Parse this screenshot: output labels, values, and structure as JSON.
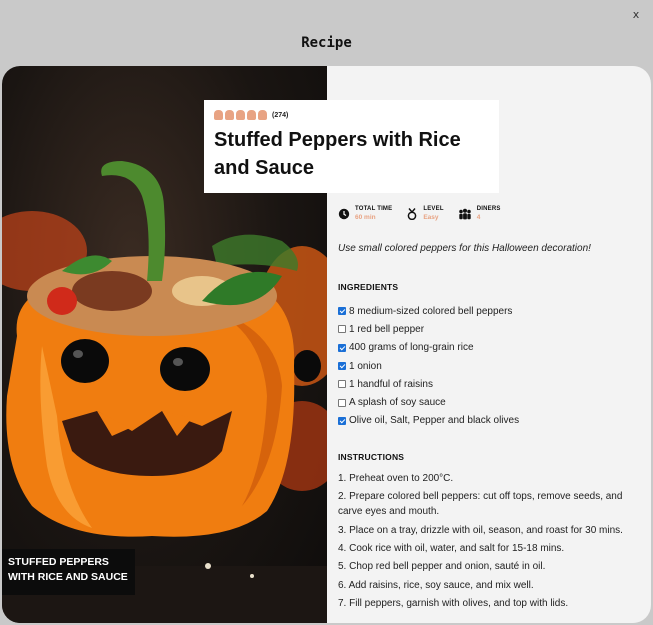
{
  "close_label": "x",
  "modal_title": "Recipe",
  "photo": {
    "caption": "STUFFED PEPPERS WITH RICE AND SAUCE"
  },
  "rating": {
    "count": "(274)",
    "star_color": "#e8a383"
  },
  "recipe": {
    "title": "Stuffed Peppers with Rice and Sauce",
    "tip": "Use small colored peppers for this Halloween decoration!"
  },
  "meta": [
    {
      "label": "TOTAL TIME",
      "value": "60 min",
      "icon": "clock-icon"
    },
    {
      "label": "LEVEL",
      "value": "Easy",
      "icon": "medal-icon"
    },
    {
      "label": "DINERS",
      "value": "4",
      "icon": "people-icon"
    }
  ],
  "ingredients_title": "INGREDIENTS",
  "ingredients": [
    {
      "text": "8 medium-sized colored bell peppers",
      "checked": true
    },
    {
      "text": "1 red bell pepper",
      "checked": false
    },
    {
      "text": "400 grams of long-grain rice",
      "checked": true
    },
    {
      "text": "1 onion",
      "checked": true
    },
    {
      "text": "1 handful of raisins",
      "checked": false
    },
    {
      "text": "A splash of soy sauce",
      "checked": false
    },
    {
      "text": "Olive oil, Salt, Pepper and black olives",
      "checked": true
    }
  ],
  "instructions_title": "INSTRUCTIONS",
  "instructions": [
    "1. Preheat oven to 200°C.",
    "2. Prepare colored bell peppers: cut off tops, remove seeds, and carve eyes and mouth.",
    "3. Place on a tray, drizzle with oil, season, and roast for 30 mins.",
    "4. Cook rice with oil, water, and salt for 15-18 mins.",
    "5. Chop red bell pepper and onion, sauté in oil.",
    "6. Add raisins, rice, soy sauce, and mix well.",
    "7. Fill peppers, garnish with olives, and top with lids."
  ],
  "colors": {
    "accent": "#e8a383",
    "checkbox": "#1a6fd6"
  }
}
